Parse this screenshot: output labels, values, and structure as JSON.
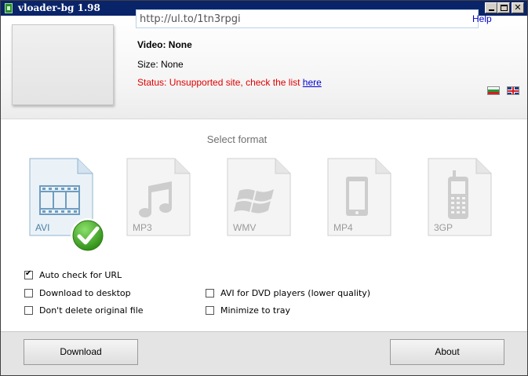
{
  "window": {
    "title": "vloader-bg 1.98",
    "controls": {
      "minimize": "minimize",
      "maximize": "maximize",
      "close": "✕"
    }
  },
  "header": {
    "url_value": "http://ul.to/1tn3rpgi",
    "help_label": "Help",
    "video_label": "Video: None",
    "size_label": "Size: None",
    "status_text": "Status: Unsupported site, check the list ",
    "status_link": "here",
    "flags": [
      "bulgarian-flag",
      "english-flag"
    ]
  },
  "formats": {
    "title": "Select format",
    "selected": "AVI",
    "items": [
      {
        "label": "AVI",
        "icon": "film-icon"
      },
      {
        "label": "MP3",
        "icon": "music-note-icon"
      },
      {
        "label": "WMV",
        "icon": "windows-logo-icon"
      },
      {
        "label": "MP4",
        "icon": "tablet-icon"
      },
      {
        "label": "3GP",
        "icon": "mobile-phone-icon"
      }
    ]
  },
  "options": {
    "auto_check": {
      "label": "Auto check for URL",
      "checked": true
    },
    "download_desktop": {
      "label": "Download to desktop",
      "checked": false
    },
    "keep_original": {
      "label": "Don't delete original file",
      "checked": false
    },
    "avi_dvd": {
      "label": "AVI for DVD players (lower quality)",
      "checked": false
    },
    "minimize_tray": {
      "label": "Minimize to tray",
      "checked": false
    }
  },
  "footer": {
    "download_label": "Download",
    "about_label": "About"
  },
  "colors": {
    "titlebar": "#0a246a",
    "status_error": "#e00000",
    "link": "#0000cc",
    "selected_format": "#4a7fa6",
    "check_green": "#3aa81f"
  }
}
